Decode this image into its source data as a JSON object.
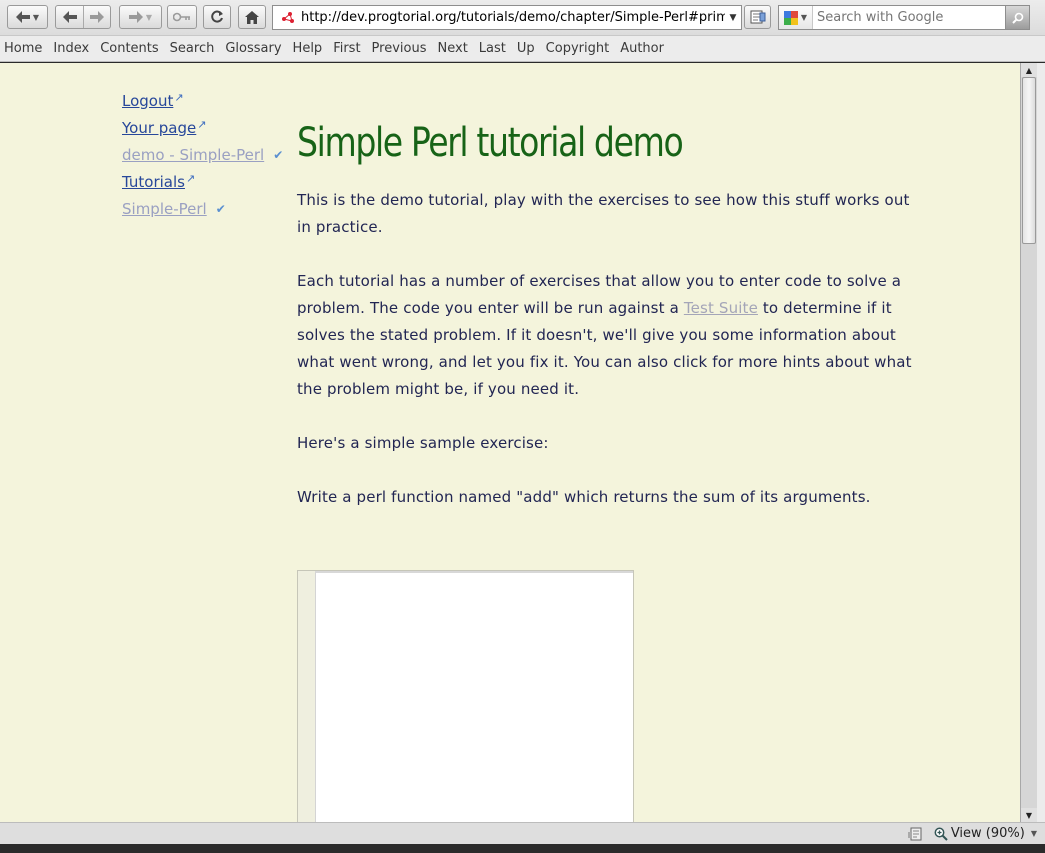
{
  "browser": {
    "url": "http://dev.progtorial.org/tutorials/demo/chapter/Simple-Perl#prime_",
    "search_placeholder": "Search with Google",
    "icons": {
      "back": "back-arrow-icon",
      "forward": "forward-arrow-icon",
      "reload": "reload-icon",
      "home": "home-icon",
      "key": "key-icon",
      "search_engine": "google-icon",
      "search_go": "magnifier-icon"
    }
  },
  "linkbar": {
    "items": [
      "Home",
      "Index",
      "Contents",
      "Search",
      "Glossary",
      "Help",
      "First",
      "Previous",
      "Next",
      "Last",
      "Up",
      "Copyright",
      "Author"
    ]
  },
  "sidebar": {
    "items": [
      {
        "label": "Logout"
      },
      {
        "label": "Your page"
      },
      {
        "label": "demo - Simple-Perl"
      },
      {
        "label": "Tutorials"
      },
      {
        "label": "Simple-Perl"
      }
    ]
  },
  "page": {
    "title": "Simple Perl tutorial demo",
    "p1": "This is the demo tutorial, play with the exercises to see how this stuff works out in practice.",
    "p2_before": "Each tutorial has a number of exercises that allow you to enter code to solve a problem. The code you enter will be run against a ",
    "p2_link": "Test Suite",
    "p2_after": " to determine if it solves the stated problem. If it doesn't, we'll give you some information about what went wrong, and let you fix it. You can also click for more hints about what the problem might be, if you need it.",
    "p3": "Here's a simple sample exercise:",
    "p4": "Write a perl function named \"add\" which returns the sum of its arguments."
  },
  "status": {
    "zoom_label": "View (90%)"
  },
  "colors": {
    "page_bg": "#f4f4dc",
    "title": "#176317",
    "body_text": "#222653",
    "link": "#27479a",
    "visited_link": "#9aa0c2"
  }
}
